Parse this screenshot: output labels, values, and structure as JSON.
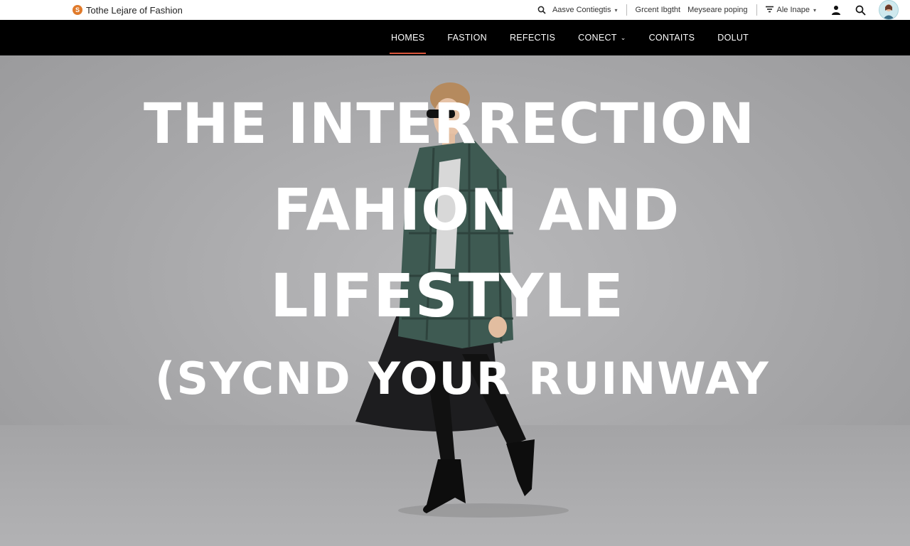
{
  "brand": {
    "name": "Tothe Lejare of Fashion",
    "logo_glyph": "S",
    "logo_color": "#e07a2a"
  },
  "utility": {
    "search_label": "Aasve Contiegtis",
    "link_1": "Grcent Ibgtht",
    "link_2": "Meyseare poping",
    "filter_label": "Ale Inape",
    "icons": [
      "search-icon",
      "user-icon",
      "search-icon",
      "avatar"
    ]
  },
  "nav": {
    "items": [
      "HOMES",
      "FASTION",
      "REFECTIS",
      "CONECT",
      "CONTAITS",
      "DOLUT"
    ],
    "active_index": 0,
    "accent": "#d8553b"
  },
  "hero": {
    "line1": "THE INTERRECTION",
    "line2": "FAHION AND",
    "line3": "LIFESTYLE",
    "line4": "(SYCND YOUR RUINWAY"
  }
}
